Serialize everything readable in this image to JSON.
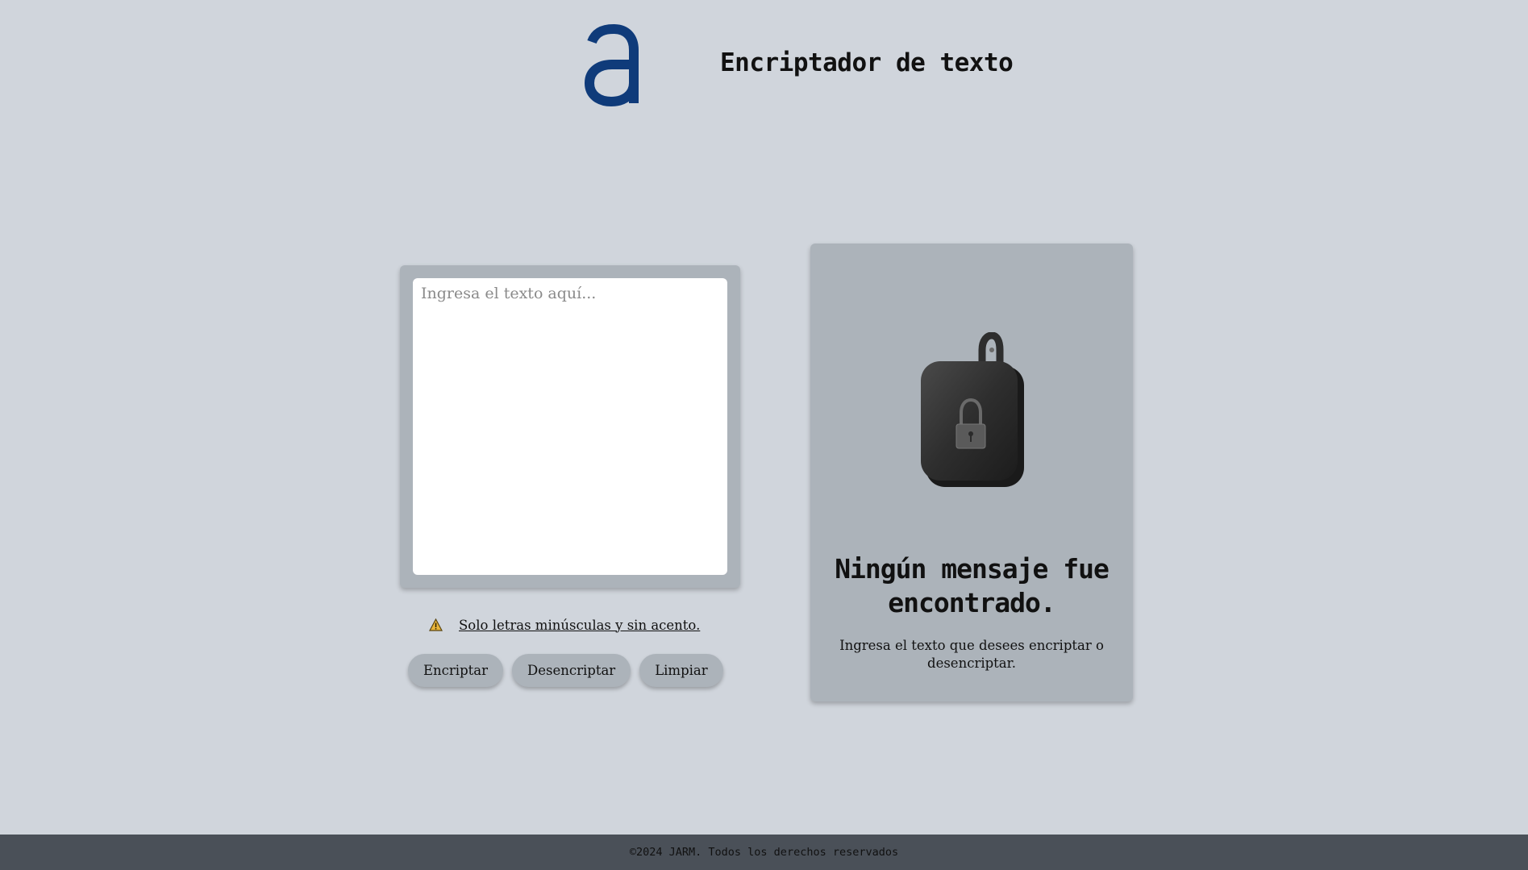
{
  "header": {
    "title": "Encriptador de texto",
    "logo_icon": "letter-a-logo",
    "logo_color": "#0f3b7a"
  },
  "input": {
    "placeholder": "Ingresa el texto aquí...",
    "value": ""
  },
  "warning": {
    "icon": "warning-triangle-icon",
    "text": "Solo letras minúsculas y sin acento."
  },
  "buttons": {
    "encrypt": "Encriptar",
    "decrypt": "Desencriptar",
    "clear": "Limpiar"
  },
  "output": {
    "illustration": "padlock-device-icon",
    "title": "Ningún mensaje fue encontrado.",
    "text": "Ingresa el texto que desees encriptar o desencriptar."
  },
  "footer": {
    "text": "©2024 JARM. Todos los derechos reservados"
  },
  "colors": {
    "background": "#d0d5dc",
    "panel": "#acb3ba",
    "footer": "#4a5058"
  }
}
